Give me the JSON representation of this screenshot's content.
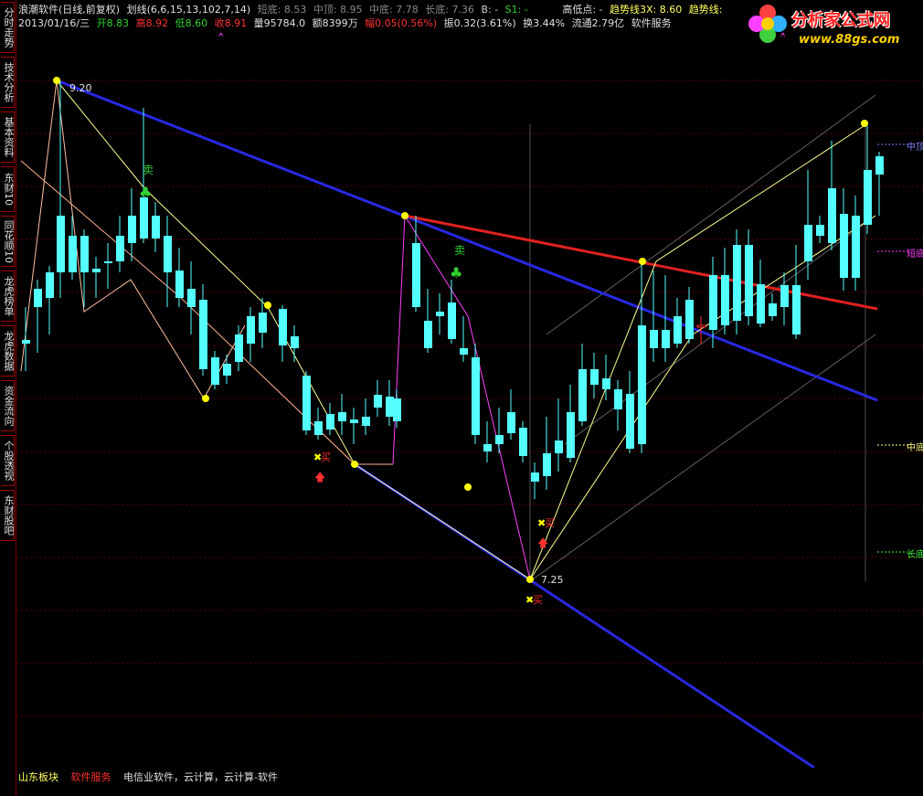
{
  "sidebar": {
    "tabs": [
      {
        "label": "分时走势"
      },
      {
        "label": "技术分析"
      },
      {
        "label": "基本资料"
      },
      {
        "label": "东财10"
      },
      {
        "label": "同花顺10"
      },
      {
        "label": "龙虎榜单"
      },
      {
        "label": "龙虎数据"
      },
      {
        "label": "资金流向"
      },
      {
        "label": "个股透视"
      },
      {
        "label": "东财股吧"
      }
    ]
  },
  "header": {
    "row1": {
      "title": "浪潮软件(日线,前复权)",
      "formula": "划线(6,6,15,13,102,7,14)",
      "short_low": "短底: 8.53",
      "mid_top": "中顶: 8.95",
      "mid_low": "中底: 7.78",
      "long_low": "长底: 7.36",
      "b": "B: -",
      "s1": "S1: -",
      "hilo": "高低点: -",
      "trend3x": "趋势线3X: 8.60",
      "trend": "趋势线:"
    },
    "row2": {
      "date": "2013/01/16/三",
      "open": "开8.83",
      "high": "高8.92",
      "low": "低8.60",
      "close": "收8.91",
      "volume": "量95784.0",
      "amount": "额8399万",
      "change": "幅0.05(0.56%)",
      "amplitude": "振0.32(3.61%)",
      "turnover": "换3.44%",
      "float": "流通2.79亿",
      "sector": "软件服务"
    }
  },
  "logo": {
    "title": "分析家公式网",
    "url": "www.88gs.com"
  },
  "annotations": {
    "high_price": "9.20",
    "low_price": "7.25",
    "sell_label_1": "卖",
    "sell_label_2": "卖",
    "buy_label_1": "买",
    "buy_label_2": "买",
    "buy_label_3": "买"
  },
  "right_labels": {
    "mid_top": "中顶",
    "short_low": "短底",
    "mid_low": "中底",
    "long_low": "长底"
  },
  "footer": {
    "region": "山东板块",
    "industry": "软件服务",
    "concepts": "电信业软件，云计算，云计算-软件"
  },
  "colors": {
    "up": "#ff3030",
    "down": "#54ffff",
    "blue_line": "#2020e0",
    "red_line": "#e02020",
    "pivot": "#ffff00"
  }
}
